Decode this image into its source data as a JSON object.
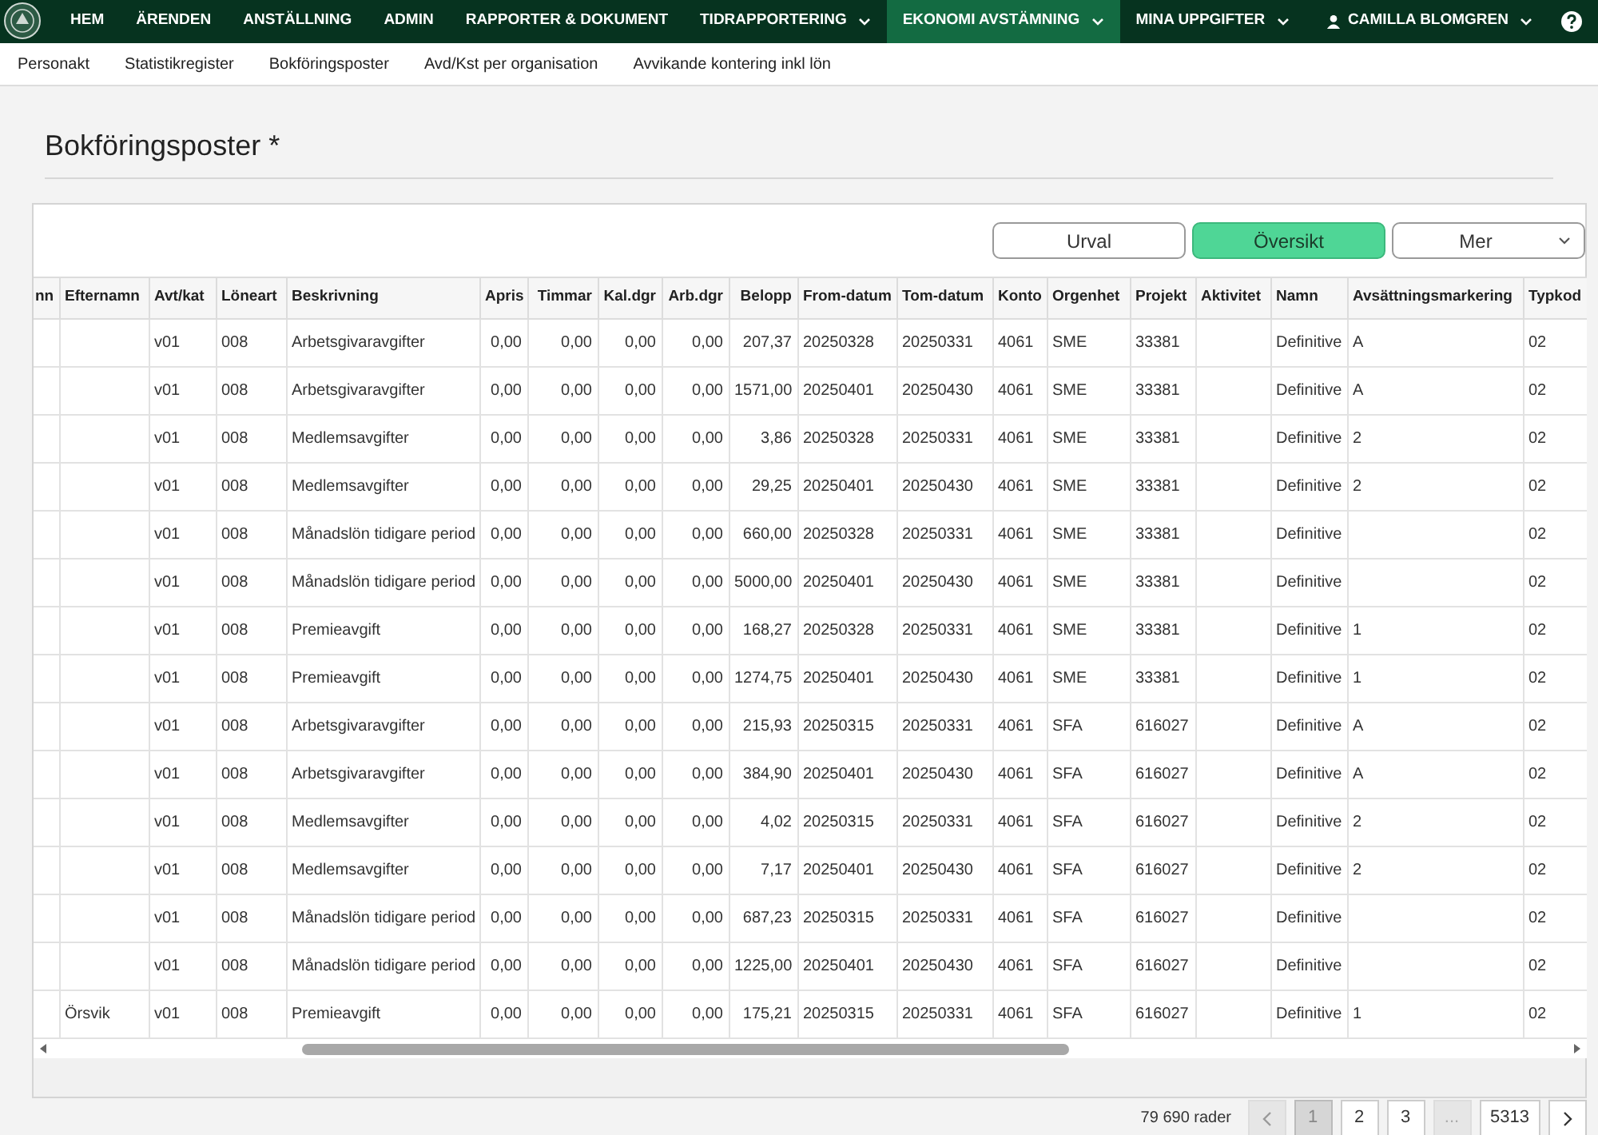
{
  "nav": {
    "items": [
      {
        "label": "HEM",
        "selected": false,
        "dropdown": false
      },
      {
        "label": "ÄRENDEN",
        "selected": false,
        "dropdown": false
      },
      {
        "label": "ANSTÄLLNING",
        "selected": false,
        "dropdown": false
      },
      {
        "label": "ADMIN",
        "selected": false,
        "dropdown": false
      },
      {
        "label": "RAPPORTER & DOKUMENT",
        "selected": false,
        "dropdown": false
      },
      {
        "label": "TIDRAPPORTERING",
        "selected": false,
        "dropdown": true
      },
      {
        "label": "EKONOMI AVSTÄMNING",
        "selected": true,
        "dropdown": true
      },
      {
        "label": "MINA UPPGIFTER",
        "selected": false,
        "dropdown": true
      }
    ],
    "user": "CAMILLA BLOMGREN"
  },
  "subnav": [
    "Personakt",
    "Statistikregister",
    "Bokföringsposter",
    "Avd/Kst per organisation",
    "Avvikande kontering inkl lön"
  ],
  "page_title": "Bokföringsposter *",
  "view_buttons": [
    {
      "label": "Urval",
      "selected": false
    },
    {
      "label": "Översikt",
      "selected": true
    }
  ],
  "more_select": "Mer",
  "table": {
    "columns": [
      "nn",
      "Efternamn",
      "Avt/kat",
      "Löneart",
      "Beskrivning",
      "Apris",
      "Timmar",
      "Kal.dgr",
      "Arb.dgr",
      "Belopp",
      "From-datum",
      "Tom-datum",
      "Konto",
      "Orgenhet",
      "Projekt",
      "Aktivitet",
      "Namn",
      "Avsättningsmarkering",
      "Typkod"
    ],
    "rows": [
      {
        "cells": [
          null,
          null,
          "v01",
          "008",
          "Arbetsgivaravgifter",
          "0,00",
          "0,00",
          "0,00",
          "0,00",
          "207,37",
          "20250328",
          "20250331",
          "4061",
          "SME",
          "33381",
          null,
          "Definitive",
          "A",
          "02"
        ]
      },
      {
        "cells": [
          null,
          null,
          "v01",
          "008",
          "Arbetsgivaravgifter",
          "0,00",
          "0,00",
          "0,00",
          "0,00",
          "1571,00",
          "20250401",
          "20250430",
          "4061",
          "SME",
          "33381",
          null,
          "Definitive",
          "A",
          "02"
        ]
      },
      {
        "cells": [
          null,
          null,
          "v01",
          "008",
          "Medlemsavgifter",
          "0,00",
          "0,00",
          "0,00",
          "0,00",
          "3,86",
          "20250328",
          "20250331",
          "4061",
          "SME",
          "33381",
          null,
          "Definitive",
          "2",
          "02"
        ]
      },
      {
        "cells": [
          null,
          null,
          "v01",
          "008",
          "Medlemsavgifter",
          "0,00",
          "0,00",
          "0,00",
          "0,00",
          "29,25",
          "20250401",
          "20250430",
          "4061",
          "SME",
          "33381",
          null,
          "Definitive",
          "2",
          "02"
        ]
      },
      {
        "cells": [
          null,
          null,
          "v01",
          "008",
          "Månadslön tidigare period",
          "0,00",
          "0,00",
          "0,00",
          "0,00",
          "660,00",
          "20250328",
          "20250331",
          "4061",
          "SME",
          "33381",
          null,
          "Definitive",
          null,
          "02"
        ]
      },
      {
        "cells": [
          null,
          null,
          "v01",
          "008",
          "Månadslön tidigare period",
          "0,00",
          "0,00",
          "0,00",
          "0,00",
          "5000,00",
          "20250401",
          "20250430",
          "4061",
          "SME",
          "33381",
          null,
          "Definitive",
          null,
          "02"
        ]
      },
      {
        "cells": [
          null,
          null,
          "v01",
          "008",
          "Premieavgift",
          "0,00",
          "0,00",
          "0,00",
          "0,00",
          "168,27",
          "20250328",
          "20250331",
          "4061",
          "SME",
          "33381",
          null,
          "Definitive",
          "1",
          "02"
        ]
      },
      {
        "cells": [
          null,
          null,
          "v01",
          "008",
          "Premieavgift",
          "0,00",
          "0,00",
          "0,00",
          "0,00",
          "1274,75",
          "20250401",
          "20250430",
          "4061",
          "SME",
          "33381",
          null,
          "Definitive",
          "1",
          "02"
        ]
      },
      {
        "cells": [
          null,
          null,
          "v01",
          "008",
          "Arbetsgivaravgifter",
          "0,00",
          "0,00",
          "0,00",
          "0,00",
          "215,93",
          "20250315",
          "20250331",
          "4061",
          "SFA",
          "616027",
          null,
          "Definitive",
          "A",
          "02"
        ]
      },
      {
        "cells": [
          null,
          null,
          "v01",
          "008",
          "Arbetsgivaravgifter",
          "0,00",
          "0,00",
          "0,00",
          "0,00",
          "384,90",
          "20250401",
          "20250430",
          "4061",
          "SFA",
          "616027",
          null,
          "Definitive",
          "A",
          "02"
        ]
      },
      {
        "cells": [
          null,
          null,
          "v01",
          "008",
          "Medlemsavgifter",
          "0,00",
          "0,00",
          "0,00",
          "0,00",
          "4,02",
          "20250315",
          "20250331",
          "4061",
          "SFA",
          "616027",
          null,
          "Definitive",
          "2",
          "02"
        ]
      },
      {
        "cells": [
          null,
          null,
          "v01",
          "008",
          "Medlemsavgifter",
          "0,00",
          "0,00",
          "0,00",
          "0,00",
          "7,17",
          "20250401",
          "20250430",
          "4061",
          "SFA",
          "616027",
          null,
          "Definitive",
          "2",
          "02"
        ]
      },
      {
        "cells": [
          null,
          null,
          "v01",
          "008",
          "Månadslön tidigare period",
          "0,00",
          "0,00",
          "0,00",
          "0,00",
          "687,23",
          "20250315",
          "20250331",
          "4061",
          "SFA",
          "616027",
          null,
          "Definitive",
          null,
          "02"
        ]
      },
      {
        "cells": [
          null,
          null,
          "v01",
          "008",
          "Månadslön tidigare period",
          "0,00",
          "0,00",
          "0,00",
          "0,00",
          "1225,00",
          "20250401",
          "20250430",
          "4061",
          "SFA",
          "616027",
          null,
          "Definitive",
          null,
          "02"
        ]
      },
      {
        "cells": [
          null,
          "Örsvik",
          "v01",
          "008",
          "Premieavgift",
          "0,00",
          "0,00",
          "0,00",
          "0,00",
          "175,21",
          "20250315",
          "20250331",
          "4061",
          "SFA",
          "616027",
          null,
          "Definitive",
          "1",
          "02"
        ]
      }
    ]
  },
  "pagination": {
    "count": "79 690 rader",
    "pages": [
      {
        "label": "1",
        "selected": true,
        "disabled": false
      },
      {
        "label": "2",
        "selected": false,
        "disabled": false
      },
      {
        "label": "3",
        "selected": false,
        "disabled": false
      },
      {
        "label": "...",
        "selected": false,
        "disabled": true
      },
      {
        "label": "5313",
        "selected": false,
        "disabled": false
      }
    ],
    "prev_disabled": true,
    "next_disabled": false
  }
}
